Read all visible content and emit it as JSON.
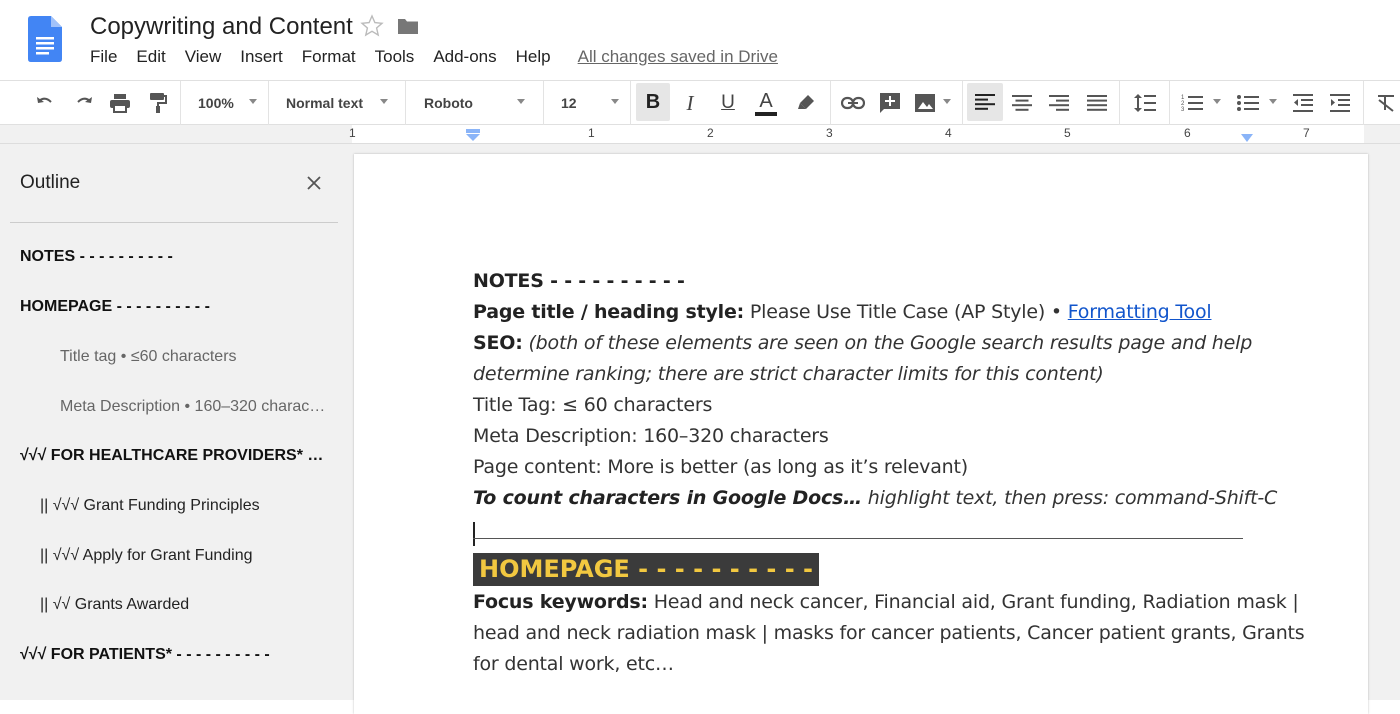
{
  "header": {
    "title": "Copywriting and Content",
    "menu": [
      "File",
      "Edit",
      "View",
      "Insert",
      "Format",
      "Tools",
      "Add-ons",
      "Help"
    ],
    "saved_status": "All changes saved in Drive"
  },
  "toolbar": {
    "zoom": "100%",
    "style": "Normal text",
    "font": "Roboto",
    "size": "12",
    "icons": [
      "undo-icon",
      "redo-icon",
      "print-icon",
      "paint-format-icon",
      "bold-icon",
      "italic-icon",
      "underline-icon",
      "text-color-icon",
      "highlight-icon",
      "link-icon",
      "comment-icon",
      "image-icon",
      "align-left-icon",
      "align-center-icon",
      "align-right-icon",
      "justify-icon",
      "line-spacing-icon",
      "numbered-list-icon",
      "bulleted-list-icon",
      "decrease-indent-icon",
      "increase-indent-icon",
      "clear-formatting-icon"
    ],
    "bold_label": "B",
    "italic_label": "I",
    "underline_label": "U",
    "text_color_label": "A"
  },
  "ruler": {
    "numbers": [
      "1",
      "1",
      "2",
      "3",
      "4",
      "5",
      "6",
      "7"
    ]
  },
  "outline": {
    "title": "Outline",
    "items": [
      {
        "text": "NOTES - - - - - - - - - -",
        "level": 1
      },
      {
        "text": "HOMEPAGE - - - - - - - - - -",
        "level": 1
      },
      {
        "text": "Title tag • ≤60 characters",
        "level": 3
      },
      {
        "text": "Meta Description • 160–320 charac…",
        "level": 3
      },
      {
        "text": "√√√ FOR HEALTHCARE PROVIDERS* …",
        "level": 1
      },
      {
        "text": "|| √√√ Grant Funding Principles",
        "level": 2
      },
      {
        "text": "|| √√√ Apply for Grant Funding",
        "level": 2
      },
      {
        "text": "|| √√ Grants Awarded",
        "level": 2
      },
      {
        "text": "√√√ FOR PATIENTS* - - - - - - - - - -",
        "level": 1
      }
    ]
  },
  "document": {
    "notes_heading": "NOTES - - - - - - - - - -",
    "page_title_label": "Page title / heading style:",
    "page_title_text": " Please Use Title Case (AP Style) • ",
    "formatting_tool_link": "Formatting Tool",
    "seo_label": "SEO:",
    "seo_text_1": " (both of these elements are seen on the Google search results page and help",
    "seo_text_2": "determine ranking; there are strict character limits for this content)",
    "title_tag_line": "Title Tag: ≤ 60 characters",
    "meta_line": "Meta Description: 160–320 characters",
    "page_content_line": "Page content: More is better (as long as it’s relevant)",
    "count_label": "To count characters in Google Docs…",
    "count_text": " highlight text, then press: command-Shift-C",
    "homepage_heading": "HOMEPAGE - - - - - - - - - -",
    "focus_label": "Focus keywords:",
    "focus_text_1": " Head and neck cancer, Financial aid, Grant funding, Radiation mask |",
    "focus_text_2": "head and neck radiation mask | masks for cancer patients, Cancer patient grants, Grants",
    "focus_text_3": "for dental work, etc…"
  },
  "colors": {
    "link": "#1155cc",
    "highlight_bg": "#3b3b3b",
    "highlight_text": "#f2c840",
    "docs_blue": "#4285f4"
  }
}
